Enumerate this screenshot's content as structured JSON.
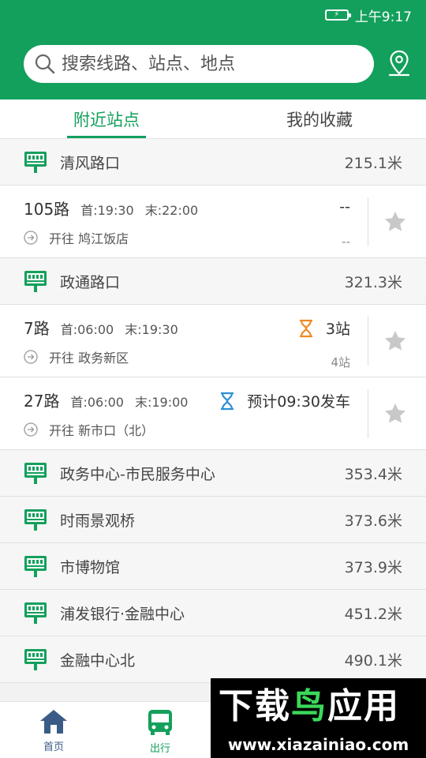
{
  "status_bar": {
    "time": "上午9:17",
    "battery_glyph": "⚡"
  },
  "search": {
    "placeholder": "搜索线路、站点、地点"
  },
  "tabs": [
    {
      "label": "附近站点",
      "active": true
    },
    {
      "label": "我的收藏",
      "active": false
    }
  ],
  "stops": [
    {
      "name": "清风路口",
      "distance": "215.1米"
    },
    {
      "name": "政通路口",
      "distance": "321.3米"
    },
    {
      "name": "政务中心-市民服务中心",
      "distance": "353.4米"
    },
    {
      "name": "时雨景观桥",
      "distance": "373.6米"
    },
    {
      "name": "市博物馆",
      "distance": "373.9米"
    },
    {
      "name": "浦发银行·金融中心",
      "distance": "451.2米"
    },
    {
      "name": "金融中心北",
      "distance": "490.1米"
    }
  ],
  "routes": [
    {
      "name": "105路",
      "first": "首:19:30",
      "last": "末:22:00",
      "direction": "开往 鸠江饭店",
      "status": "--",
      "sub": "--"
    },
    {
      "name": "7路",
      "first": "首:06:00",
      "last": "末:19:30",
      "direction": "开往 政务新区",
      "status": "3站",
      "sub": "4站",
      "status_icon": "hourglass-orange"
    },
    {
      "name": "27路",
      "first": "首:06:00",
      "last": "末:19:00",
      "direction": "开往 新市口（北）",
      "status": "预计09:30发车",
      "sub": "",
      "status_icon": "hourglass-blue"
    }
  ],
  "bottom_nav": [
    {
      "label": "首页",
      "icon": "home-icon",
      "active": false
    },
    {
      "label": "出行",
      "icon": "bus-icon",
      "active": true
    }
  ],
  "watermark": {
    "title_a": "下载",
    "title_b": "鸟",
    "title_c": "应用",
    "url": "www.xiazainiao.com"
  },
  "colors": {
    "brand": "#13a05c",
    "orange": "#f08a24",
    "blue": "#2c8fd6",
    "star": "#c8c8c8",
    "nav_inactive": "#3a5b86"
  }
}
